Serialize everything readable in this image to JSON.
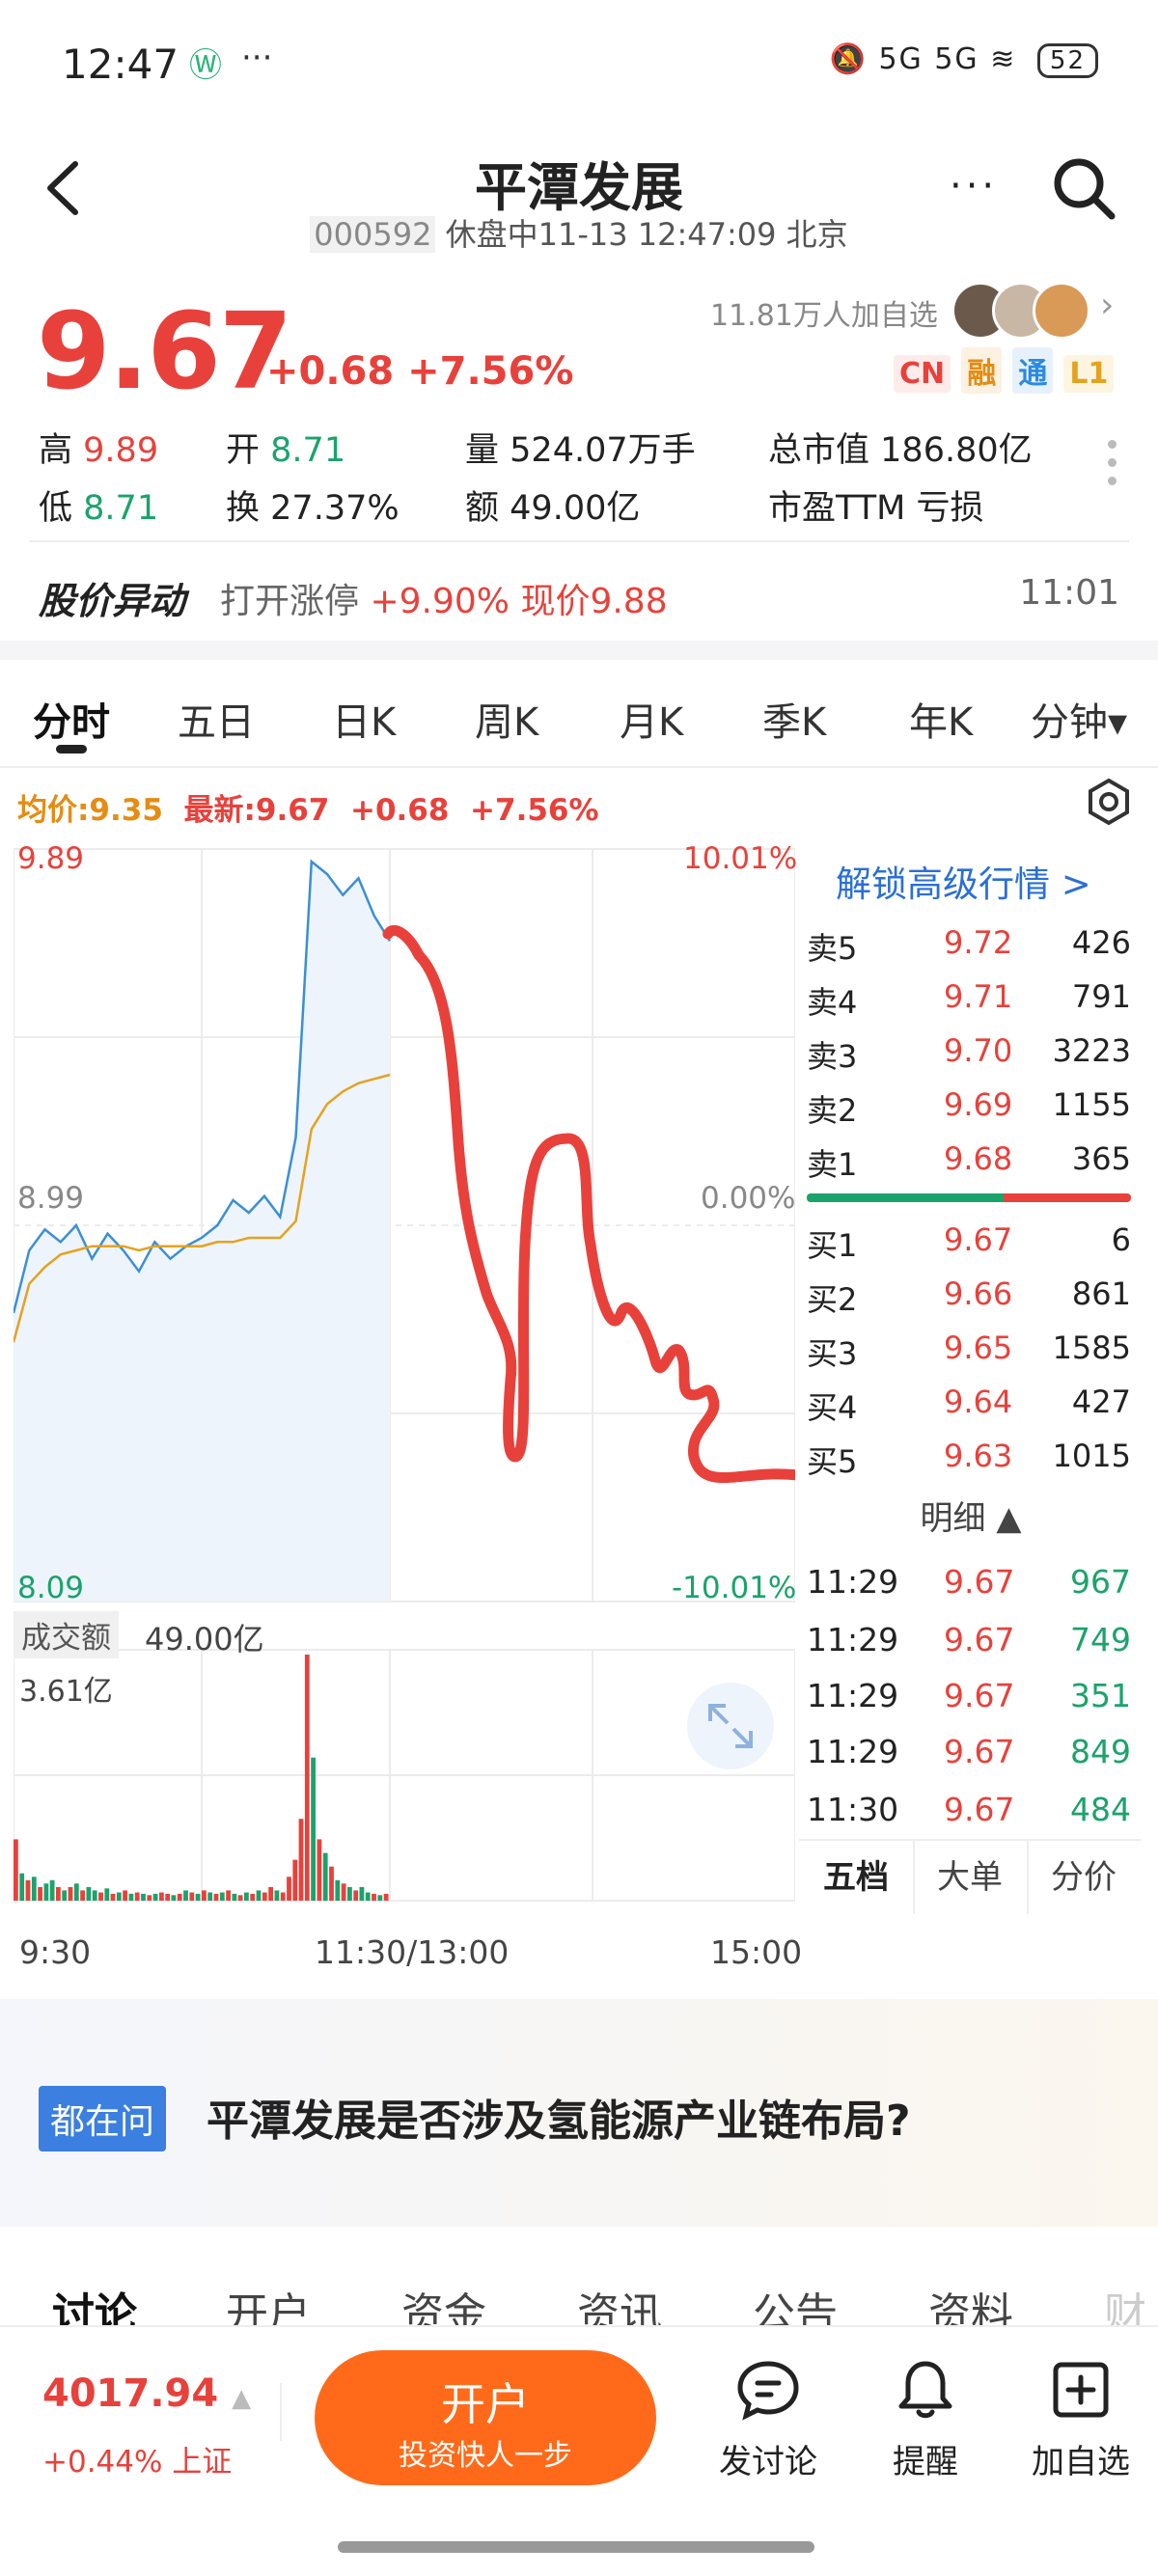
{
  "status_bar": {
    "time": "12:47",
    "extra": "···",
    "network": "5G 5G",
    "battery": "52"
  },
  "header": {
    "title": "平潭发展",
    "code": "000592",
    "subtitle": "休盘中11-13 12:47:09 北京",
    "more_label": "···"
  },
  "quote": {
    "price": "9.67",
    "change": "+0.68 +7.56%",
    "followers": "11.81万人加自选",
    "badges": [
      "CN",
      "融",
      "通",
      "L1"
    ],
    "stats": [
      {
        "label": "高",
        "value": "9.89",
        "color": "red"
      },
      {
        "label": "开",
        "value": "8.71",
        "color": "green"
      },
      {
        "label": "量",
        "value": "524.07万手",
        "color": "plain"
      },
      {
        "label": "总市值",
        "value": "186.80亿",
        "color": "plain"
      },
      {
        "label": "低",
        "value": "8.71",
        "color": "green"
      },
      {
        "label": "换",
        "value": "27.37%",
        "color": "plain"
      },
      {
        "label": "额",
        "value": "49.00亿",
        "color": "plain"
      },
      {
        "label": "市盈TTM",
        "value": "亏损",
        "color": "plain"
      }
    ]
  },
  "anomaly": {
    "title": "股价异动",
    "text_prefix": "打开涨停",
    "text_value": "+9.90% 现价9.88",
    "time": "11:01"
  },
  "period_tabs": [
    "分时",
    "五日",
    "日K",
    "周K",
    "月K",
    "季K",
    "年K",
    "分钟▾"
  ],
  "legend": {
    "avg": "均价:9.35",
    "latest": "最新:9.67",
    "change": "+0.68",
    "pct": "+7.56%"
  },
  "colors": {
    "up": "#e8413b",
    "down": "#1aa36b",
    "avg_line": "#e5a21f",
    "price_line": "#3b8fd6",
    "accent": "#ff6a1a",
    "link": "#2a6fd6"
  },
  "chart_data": {
    "type": "line",
    "title": "",
    "series": [
      {
        "name": "最新",
        "x": [
          "9:30",
          "9:35",
          "9:40",
          "9:45",
          "9:50",
          "9:55",
          "10:00",
          "10:05",
          "10:10",
          "10:15",
          "10:20",
          "10:25",
          "10:30",
          "10:35",
          "10:40",
          "10:45",
          "10:50",
          "10:55",
          "11:00",
          "11:05",
          "11:10",
          "11:15",
          "11:20",
          "11:25",
          "11:30"
        ],
        "values": [
          8.78,
          8.93,
          8.98,
          8.95,
          8.99,
          8.91,
          8.97,
          8.93,
          8.88,
          8.95,
          8.91,
          8.94,
          8.96,
          8.99,
          9.05,
          9.02,
          9.06,
          9.01,
          9.2,
          9.86,
          9.83,
          9.78,
          9.82,
          9.73,
          9.67
        ]
      },
      {
        "name": "均价",
        "x": [
          "9:30",
          "9:35",
          "9:40",
          "9:45",
          "9:50",
          "9:55",
          "10:00",
          "10:05",
          "10:10",
          "10:15",
          "10:20",
          "10:25",
          "10:30",
          "10:35",
          "10:40",
          "10:45",
          "10:50",
          "10:55",
          "11:00",
          "11:05",
          "11:10",
          "11:15",
          "11:20",
          "11:25",
          "11:30"
        ],
        "values": [
          8.71,
          8.85,
          8.89,
          8.92,
          8.93,
          8.94,
          8.94,
          8.94,
          8.93,
          8.94,
          8.94,
          8.94,
          8.94,
          8.95,
          8.95,
          8.96,
          8.96,
          8.96,
          9.0,
          9.22,
          9.28,
          9.31,
          9.33,
          9.34,
          9.35
        ]
      }
    ],
    "y_left_ticks": [
      "9.89",
      "8.99",
      "8.09"
    ],
    "y_right_ticks": [
      "10.01%",
      "0.00%",
      "-10.01%"
    ],
    "ylim": [
      8.09,
      9.89
    ],
    "x_ticks": [
      "9:30",
      "11:30/13:00",
      "15:00"
    ],
    "volume": {
      "label": "成交额",
      "total": "49.00亿",
      "max_label": "3.61亿",
      "values": [
        0.9,
        0.4,
        0.3,
        0.35,
        0.2,
        0.25,
        0.3,
        0.2,
        0.15,
        0.2,
        0.25,
        0.15,
        0.2,
        0.15,
        0.12,
        0.18,
        0.1,
        0.12,
        0.15,
        0.1,
        0.12,
        0.1,
        0.08,
        0.1,
        0.12,
        0.1,
        0.08,
        0.1,
        0.15,
        0.12,
        0.1,
        0.15,
        0.12,
        0.1,
        0.12,
        0.15,
        0.1,
        0.08,
        0.12,
        0.1,
        0.15,
        0.12,
        0.2,
        0.15,
        0.12,
        0.35,
        0.6,
        1.2,
        3.61,
        2.1,
        0.9,
        0.7,
        0.5,
        0.3,
        0.25,
        0.2,
        0.15,
        0.2,
        0.12,
        0.1,
        0.08,
        0.1
      ],
      "directions": [
        "u",
        "d",
        "u",
        "d",
        "u",
        "d",
        "d",
        "u",
        "d",
        "u",
        "d",
        "u",
        "d",
        "d",
        "u",
        "d",
        "u",
        "d",
        "u",
        "d",
        "u",
        "d",
        "u",
        "d",
        "u",
        "u",
        "d",
        "u",
        "d",
        "u",
        "d",
        "u",
        "d",
        "u",
        "d",
        "u",
        "d",
        "u",
        "d",
        "u",
        "d",
        "u",
        "u",
        "d",
        "u",
        "u",
        "u",
        "u",
        "u",
        "d",
        "u",
        "d",
        "u",
        "d",
        "u",
        "d",
        "u",
        "d",
        "d",
        "u",
        "d",
        "u"
      ]
    }
  },
  "order_book": {
    "unlock": "解锁高级行情 >",
    "asks": [
      {
        "label": "卖5",
        "price": "9.72",
        "vol": "426"
      },
      {
        "label": "卖4",
        "price": "9.71",
        "vol": "791"
      },
      {
        "label": "卖3",
        "price": "9.70",
        "vol": "3223"
      },
      {
        "label": "卖2",
        "price": "9.69",
        "vol": "1155"
      },
      {
        "label": "卖1",
        "price": "9.68",
        "vol": "365"
      }
    ],
    "bids": [
      {
        "label": "买1",
        "price": "9.67",
        "vol": "6"
      },
      {
        "label": "买2",
        "price": "9.66",
        "vol": "861"
      },
      {
        "label": "买3",
        "price": "9.65",
        "vol": "1585"
      },
      {
        "label": "买4",
        "price": "9.64",
        "vol": "427"
      },
      {
        "label": "买5",
        "price": "9.63",
        "vol": "1015"
      }
    ],
    "detail_label": "明细 ▲",
    "ticks": [
      {
        "time": "11:29",
        "price": "9.67",
        "vol": "967"
      },
      {
        "time": "11:29",
        "price": "9.67",
        "vol": "749"
      },
      {
        "time": "11:29",
        "price": "9.67",
        "vol": "351"
      },
      {
        "time": "11:29",
        "price": "9.67",
        "vol": "849"
      },
      {
        "time": "11:30",
        "price": "9.67",
        "vol": "484"
      }
    ],
    "tabs": [
      "五档",
      "大单",
      "分价"
    ]
  },
  "question": {
    "tag": "都在问",
    "text": "平潭发展是否涉及氢能源产业链布局?"
  },
  "bottom_tabs": [
    "讨论",
    "开户",
    "资金",
    "资讯",
    "公告",
    "资料",
    "财"
  ],
  "bottom_bar": {
    "index_value": "4017.94",
    "index_arrow": "▲",
    "index_change": "+0.44% 上证",
    "open_title": "开户",
    "open_sub": "投资快人一步",
    "actions": [
      "发讨论",
      "提醒",
      "加自选"
    ]
  }
}
